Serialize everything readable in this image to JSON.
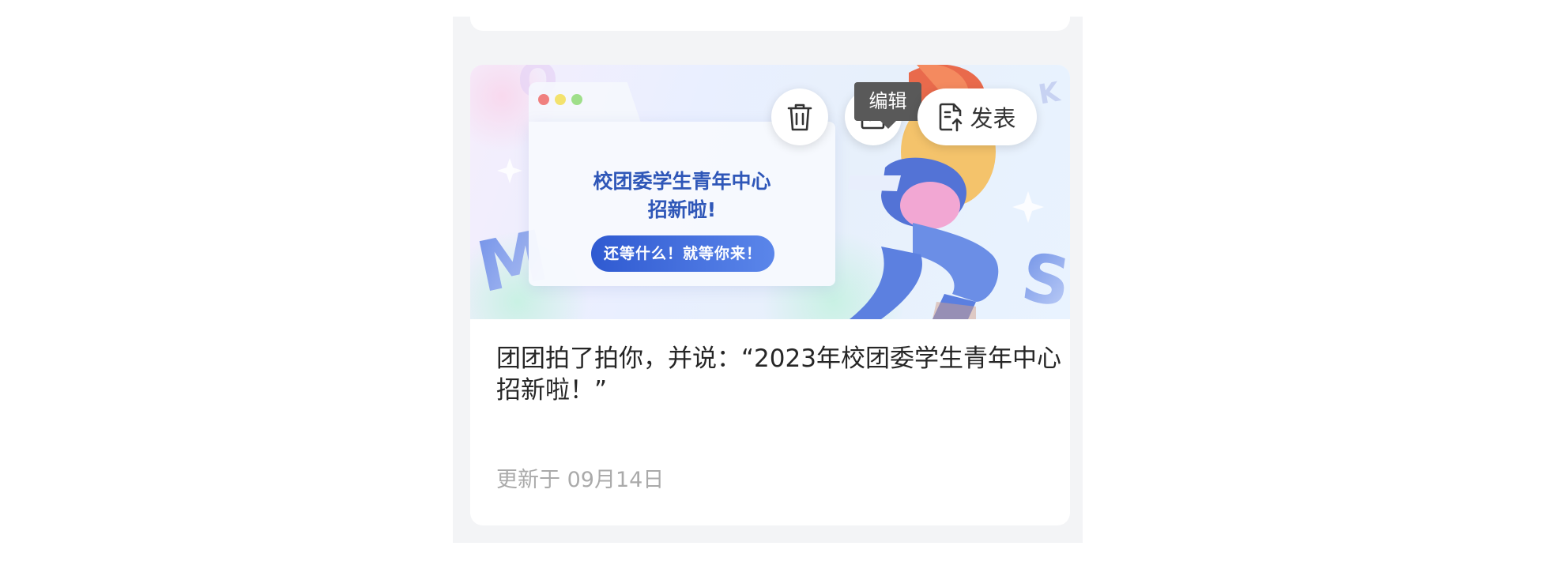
{
  "tooltip": {
    "text": "编辑"
  },
  "card": {
    "banner": {
      "heading_line1": "校团委学生青年中心",
      "heading_line2": "招新啦!",
      "cta_label": "还等什么！就等你来！"
    },
    "actions": {
      "delete_icon": "trash-icon",
      "edit_icon": "edit-icon",
      "publish_icon": "publish-icon",
      "publish_label": "发表"
    },
    "description": "团团拍了拍你，并说：“2023年校团委学生青年中心招新啦！”",
    "updated": "更新于 09月14日"
  },
  "colors": {
    "accent_blue": "#2f57b8",
    "tooltip_bg": "#595959",
    "panel_bg": "#f3f4f6",
    "meta_text": "#aaaaaa"
  }
}
